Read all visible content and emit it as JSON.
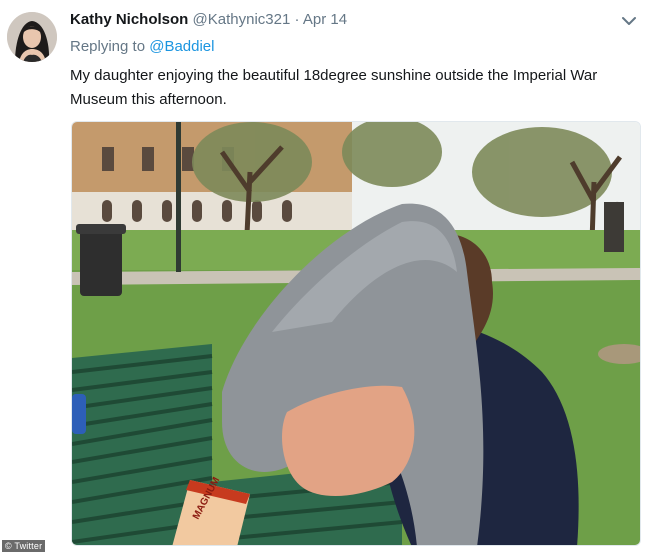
{
  "tweet": {
    "author_name": "Kathy Nicholson",
    "handle": "@Kathynic321",
    "separator": "·",
    "date": "Apr 14",
    "replying_prefix": "Replying to",
    "replying_mention": "@Baddiel",
    "text": "My daughter enjoying the beautiful 18degree sunshine outside the Imperial War Museum this afternoon.",
    "menu_icon": "chevron-down-icon",
    "avatar_icon": "avatar"
  },
  "photo": {
    "wrapper_text": "MAGNUM",
    "scene": "girl-under-grey-hoodie-on-green-bench"
  },
  "watermark": {
    "text": "© Twitter"
  },
  "colors": {
    "link": "#1b95e0",
    "secondary_text": "#657786",
    "primary_text": "#14171a"
  }
}
